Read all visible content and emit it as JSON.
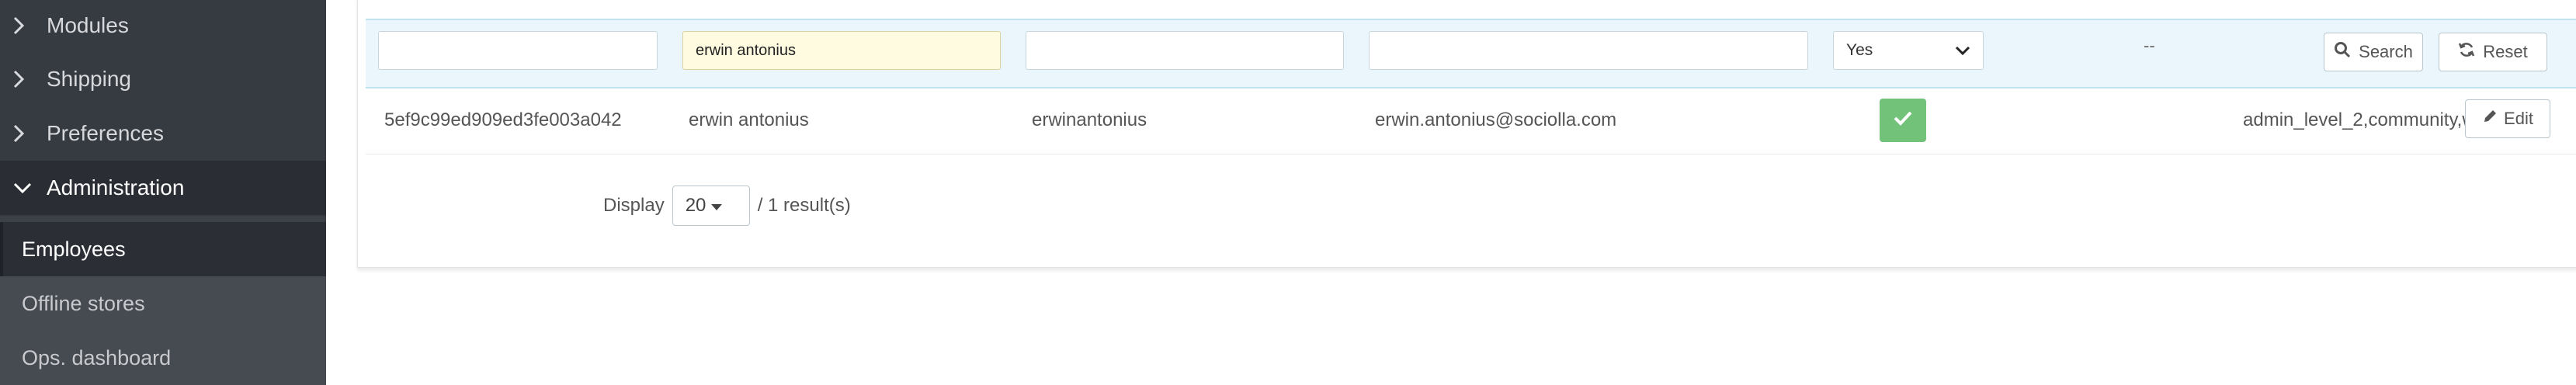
{
  "sidebar": {
    "items": [
      {
        "label": "Modules"
      },
      {
        "label": "Shipping"
      },
      {
        "label": "Preferences"
      },
      {
        "label": "Administration"
      }
    ],
    "subitems": [
      {
        "label": "Employees"
      },
      {
        "label": "Offline stores"
      },
      {
        "label": "Ops. dashboard"
      }
    ]
  },
  "filters": {
    "id_value": "",
    "name_value": "erwin antonius",
    "login_value": "",
    "email_value": "",
    "active_value": "Yes",
    "roles_placeholder": "--",
    "search_label": "Search",
    "reset_label": "Reset"
  },
  "rows": [
    {
      "id": "5ef9c99ed909ed3fe003a042",
      "name": "erwin antonius",
      "login": "erwinantonius",
      "email": "erwin.antonius@sociolla.com",
      "active": true,
      "roles": "admin_level_2,community,wm...",
      "edit_label": "Edit"
    }
  ],
  "pagination": {
    "display_label": "Display",
    "per_page": "20",
    "result_text": "/ 1 result(s)"
  },
  "colors": {
    "sidebar_bg": "#363a41",
    "filter_row_bg": "#eaf6fb",
    "active_badge": "#72c279",
    "highlight_input": "#fffbe0"
  }
}
